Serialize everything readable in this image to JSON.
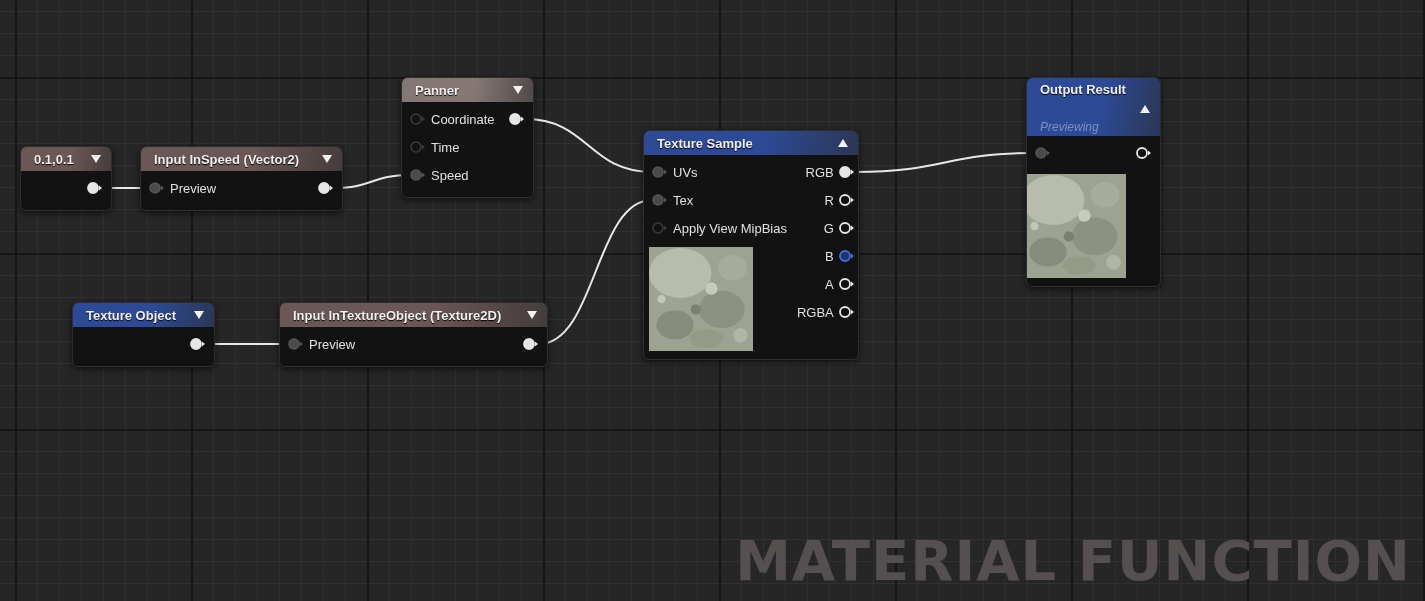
{
  "canvas": {
    "label": "MATERIAL FUNCTION"
  },
  "nodes": [
    {
      "title": "0.1,0.1",
      "color": "#6b5755",
      "expanded": false,
      "outputs": [
        {
          "connected": true
        }
      ]
    },
    {
      "title": "Input InSpeed (Vector2)",
      "color": "#6b5755",
      "expanded": false,
      "inputs": [
        {
          "label": "Preview",
          "connected": true
        }
      ],
      "outputs": [
        {
          "connected": true
        }
      ]
    },
    {
      "title": "Panner",
      "color": "#857774",
      "expanded": false,
      "inputs": [
        {
          "label": "Coordinate",
          "connected": false
        },
        {
          "label": "Time",
          "connected": false
        },
        {
          "label": "Speed",
          "connected": true
        }
      ],
      "outputs": [
        {
          "connected": true
        }
      ]
    },
    {
      "title": "Texture Object",
      "color": "#2c4a96",
      "expanded": false,
      "outputs": [
        {
          "connected": true
        }
      ]
    },
    {
      "title": "Input InTextureObject (Texture2D)",
      "color": "#6b5755",
      "expanded": false,
      "inputs": [
        {
          "label": "Preview",
          "connected": true
        }
      ],
      "outputs": [
        {
          "connected": true
        }
      ]
    },
    {
      "title": "Texture Sample",
      "color": "#2c4a96",
      "expanded": true,
      "preview": {
        "kind": "picture"
      },
      "inputs": [
        {
          "label": "UVs",
          "connected": true
        },
        {
          "label": "Tex",
          "connected": true
        },
        {
          "label": "Apply View MipBias",
          "connected": false
        }
      ],
      "outputs": [
        {
          "label": "RGB",
          "connected": true,
          "highlighted": false
        },
        {
          "label": "R",
          "connected": false,
          "highlighted": false
        },
        {
          "label": "G",
          "connected": false,
          "highlighted": false
        },
        {
          "label": "B",
          "connected": false,
          "highlighted": true
        },
        {
          "label": "A",
          "connected": false,
          "highlighted": false
        },
        {
          "label": "RGBA",
          "connected": false,
          "highlighted": false
        }
      ]
    },
    {
      "title": "Output Result",
      "subtitle": "Previewing",
      "color": "#2c4a96",
      "expanded": true,
      "preview": {
        "kind": "picture"
      },
      "inputs": [
        {
          "connected": true
        }
      ],
      "outputs": [
        {
          "connected": false
        }
      ]
    }
  ]
}
